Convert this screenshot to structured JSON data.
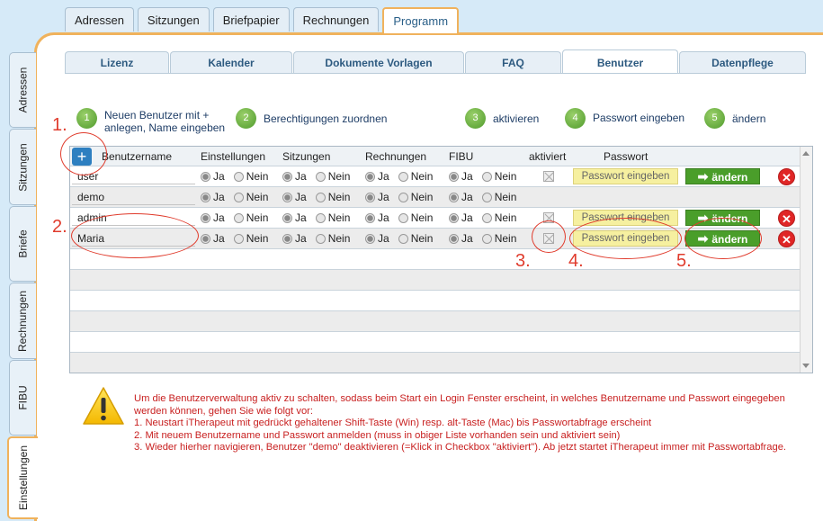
{
  "top_tabs": [
    "Adressen",
    "Sitzungen",
    "Briefpapier",
    "Rechnungen",
    "Programm"
  ],
  "top_active": "Programm",
  "left_tabs": [
    "Adressen",
    "Sitzungen",
    "Briefe",
    "Rechnungen",
    "FIBU",
    "Einstellungen"
  ],
  "left_active": "Einstellungen",
  "sub_tabs": [
    "Lizenz",
    "Kalender",
    "Dokumente Vorlagen",
    "FAQ",
    "Benutzer",
    "Datenpflege"
  ],
  "sub_active": "Benutzer",
  "steps": [
    {
      "num": "1",
      "label": "Neuen Benutzer mit +",
      "label2": "anlegen, Name eingeben"
    },
    {
      "num": "2",
      "label": "Berechtigungen zuordnen"
    },
    {
      "num": "3",
      "label": "aktivieren"
    },
    {
      "num": "4",
      "label": "Passwort eingeben"
    },
    {
      "num": "5",
      "label": "ändern"
    }
  ],
  "table": {
    "add_label": "+",
    "headers": {
      "name": "Benutzername",
      "einstellungen": "Einstellungen",
      "sitzungen": "Sitzungen",
      "rechnungen": "Rechnungen",
      "fibu": "FIBU",
      "aktiviert": "aktiviert",
      "passwort": "Passwort"
    },
    "radio_yes": "Ja",
    "radio_no": "Nein",
    "password_button": "Passwort eingeben",
    "change_button": "ändern",
    "rows": [
      {
        "name": "user",
        "actions": true
      },
      {
        "name": "demo",
        "actions": false
      },
      {
        "name": "admin",
        "actions": true
      },
      {
        "name": "Maria",
        "actions": true
      }
    ]
  },
  "annotations": [
    "1.",
    "2.",
    "3.",
    "4.",
    "5."
  ],
  "warning": {
    "intro": "Um die Benutzerverwaltung aktiv zu schalten, sodass beim Start ein Login Fenster erscheint, in welches Benutzername und Passwort eingegeben werden können, gehen Sie wie folgt vor:",
    "line1": "1. Neustart iTherapeut mit gedrückt gehaltener Shift-Taste (Win) resp. alt-Taste (Mac) bis Passwortabfrage erscheint",
    "line2": "2. Mit neuem Benutzername und Passwort anmelden (muss in obiger Liste vorhanden sein und aktiviert sein)",
    "line3": "3. Wieder hierher navigieren, Benutzer \"demo\" deaktivieren (=Klick in Checkbox \"aktiviert\"). Ab jetzt startet iTherapeut immer mit Passwortabfrage."
  },
  "colors": {
    "accent": "#f0b25c",
    "annotation": "#e03b2c",
    "green": "#4a9e2a",
    "warning_text": "#c82020"
  }
}
